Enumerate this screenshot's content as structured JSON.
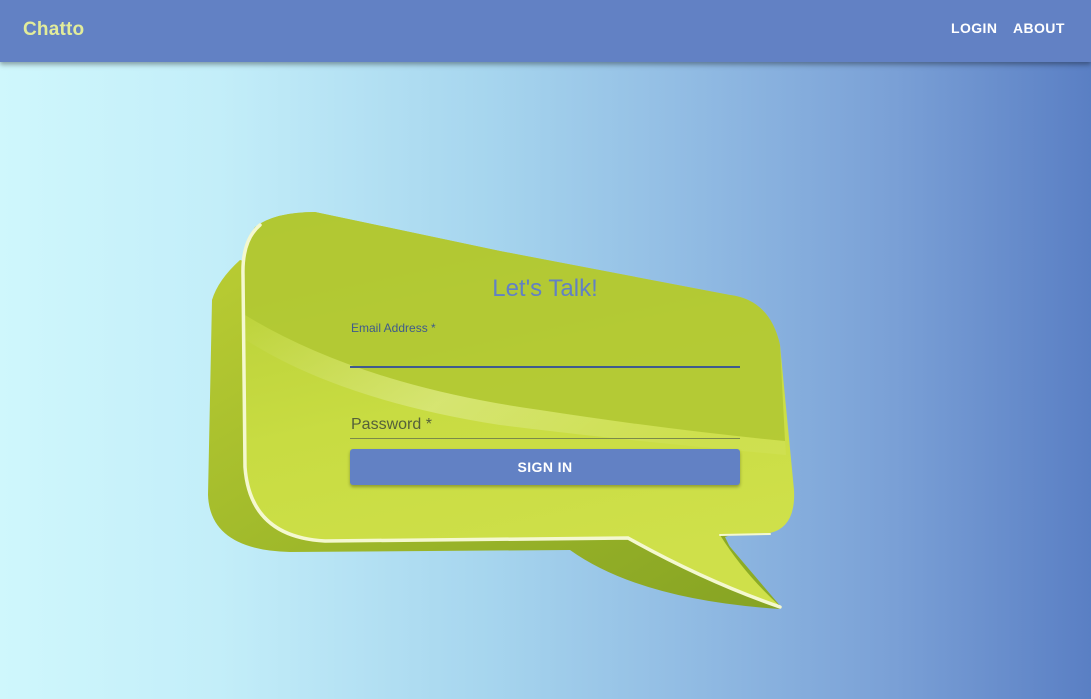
{
  "appbar": {
    "brand": "Chatto",
    "nav": {
      "login": "LOGIN",
      "about": "ABOUT"
    }
  },
  "form": {
    "title": "Let's Talk!",
    "email": {
      "label": "Email Address *",
      "value": ""
    },
    "password": {
      "label": "Password *",
      "value": ""
    },
    "submit_label": "SIGN IN"
  },
  "colors": {
    "appbar": "#6281c4",
    "brand_text": "#e2ec9a",
    "bubble": "#c4d93b",
    "accent": "#6281c4"
  },
  "icons": {
    "bubble": "speech-bubble-graphic"
  }
}
